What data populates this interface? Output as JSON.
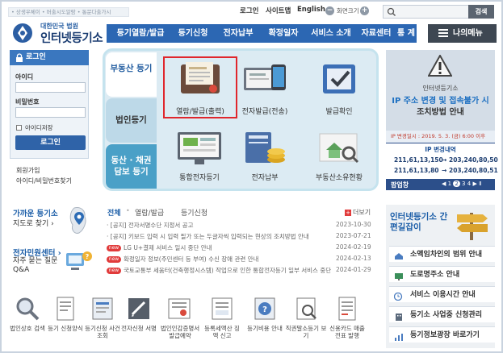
{
  "top_bar": {
    "links_text": "• 상생우체이 • 버출시도알람 • 통문다출가시",
    "login": "로그인",
    "sitemap": "사이트맵",
    "english": "English",
    "zoom_label": "화면크기",
    "search_button": "검색"
  },
  "logo": {
    "sub": "대한민국 법원",
    "main": "인터넷등기소"
  },
  "gnb": {
    "items": [
      "등기열람/발급",
      "등기신청",
      "전자납부",
      "확정일자",
      "서비스 소개",
      "자료센터",
      "통 계"
    ],
    "my_menu": "나의메뉴"
  },
  "login": {
    "title": "로그인",
    "id_label": "아이디",
    "pw_label": "비밀번호",
    "save_id": "아이디저장",
    "button": "로그인",
    "join": "회원가입",
    "find": "아이디/비밀번호찾기"
  },
  "categories": [
    {
      "label": "부동산 등기"
    },
    {
      "label": "법인등기"
    },
    {
      "label": "동산 · 채권 담보 등기"
    }
  ],
  "services": [
    {
      "label": "열람/발급(출력)"
    },
    {
      "label": "전자발급(전송)"
    },
    {
      "label": "발급확인"
    },
    {
      "label": "통합전자등기"
    },
    {
      "label": "전자납부"
    },
    {
      "label": "부동산소유현황"
    }
  ],
  "notice": {
    "org": "인터넷등기소",
    "headline": "IP 주소 변경 및 접속불가 시",
    "sub": "조치방법 안내",
    "date_line": "IP 변경일시 : 2019. 5. 3. (금) 6:00 이후",
    "ip_title": "IP 변경내역",
    "ip_rows": [
      {
        "from": "211,61,13,150",
        "to": "203,240,80,50"
      },
      {
        "from": "211,61,13,80",
        "to": "203,240,80,51"
      }
    ],
    "arrow": "→",
    "banner_label": "팝업창",
    "pages": [
      "1",
      "2",
      "3",
      "4"
    ]
  },
  "help": {
    "nearby_title": "가까운 등기소",
    "nearby_sub": "지도로 찾기 ›",
    "center_title": "전자민원센터 ›",
    "center_sub": "자주 묻는 질문 Q&A"
  },
  "news": {
    "tabs": [
      "전체",
      "열람/발급",
      "등기신청"
    ],
    "more": "더보기",
    "rows": [
      {
        "text": "[공지] 전자서명수단 지정서 공고",
        "date": "2023-10-30",
        "new": false
      },
      {
        "text": "[공지] 키보드 입력 시 입력 필가 또는 두글자씩 입력되는 현상의 조치방법 안내",
        "date": "2023-07-21",
        "new": false
      },
      {
        "text": "LG U+결제 서비스 일시 중단 안내",
        "date": "2024-02-19",
        "new": true
      },
      {
        "text": "확정일자 정보(주민센터 등 부여) 수신 장애 관련 안내",
        "date": "2024-02-13",
        "new": true
      },
      {
        "text": "국토교통부 세움터(건축행정시스템) 작업으로 인한 통합전자등기 일부 서비스 중단 안내",
        "date": "2024-01-29",
        "new": true
      }
    ]
  },
  "quick_icons": [
    {
      "label": "법인상호 검색"
    },
    {
      "label": "등기 신청양식"
    },
    {
      "label": "등기신청 사건조회"
    },
    {
      "label": "전자신청 서명"
    },
    {
      "label": "법인인감증명서 발급예약"
    },
    {
      "label": "등록세액산 징액 신고"
    },
    {
      "label": "등기비용 안내"
    },
    {
      "label": "직권말소등기 보기"
    },
    {
      "label": "신용카드 매출전표 발행"
    }
  ],
  "guide": {
    "title": "인터넷등기소 간편길잡이",
    "buttons": [
      "소액임차인의 범위 안내",
      "도로명주소 안내",
      "서비스 이용시간 안내",
      "등기소 사업중 신청관리",
      "등기정보광장 바로가기"
    ]
  },
  "colors": {
    "brand_blue": "#2c67b3",
    "dark_navy": "#1b3d72",
    "highlight_red": "#e0262c",
    "notice_blue": "#2c4f8a"
  }
}
